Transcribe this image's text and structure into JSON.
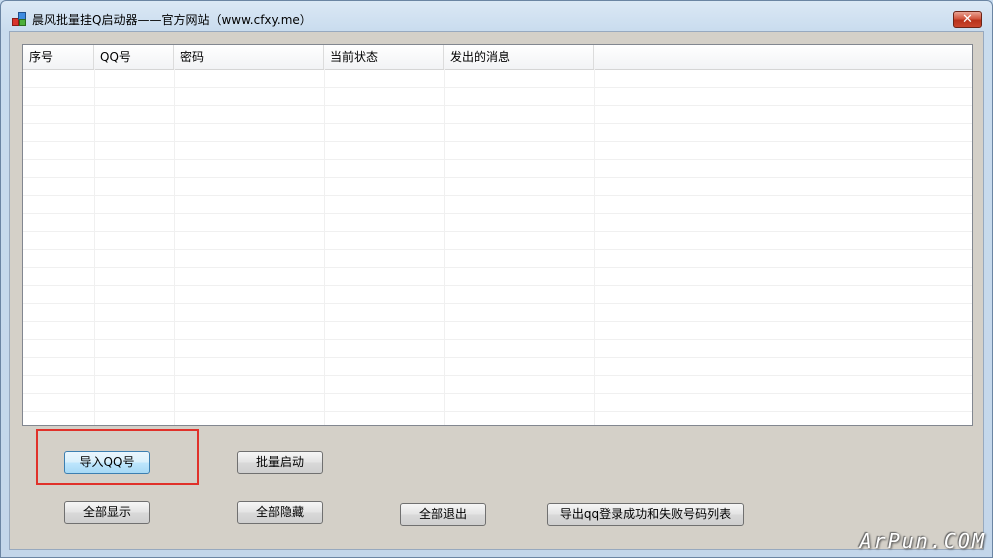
{
  "window": {
    "title": "晨风批量挂Q启动器——官方网站（www.cfxy.me）",
    "close_glyph": "✕"
  },
  "table": {
    "columns": [
      "序号",
      "QQ号",
      "密码",
      "当前状态",
      "发出的消息"
    ],
    "rows": []
  },
  "buttons": {
    "import": "导入QQ号",
    "batch_start": "批量启动",
    "show_all": "全部显示",
    "hide_all": "全部隐藏",
    "exit_all": "全部退出",
    "export": "导出qq登录成功和失败号码列表"
  },
  "watermark": "ArPun.COM",
  "colors": {
    "highlight": "#e0312a"
  }
}
